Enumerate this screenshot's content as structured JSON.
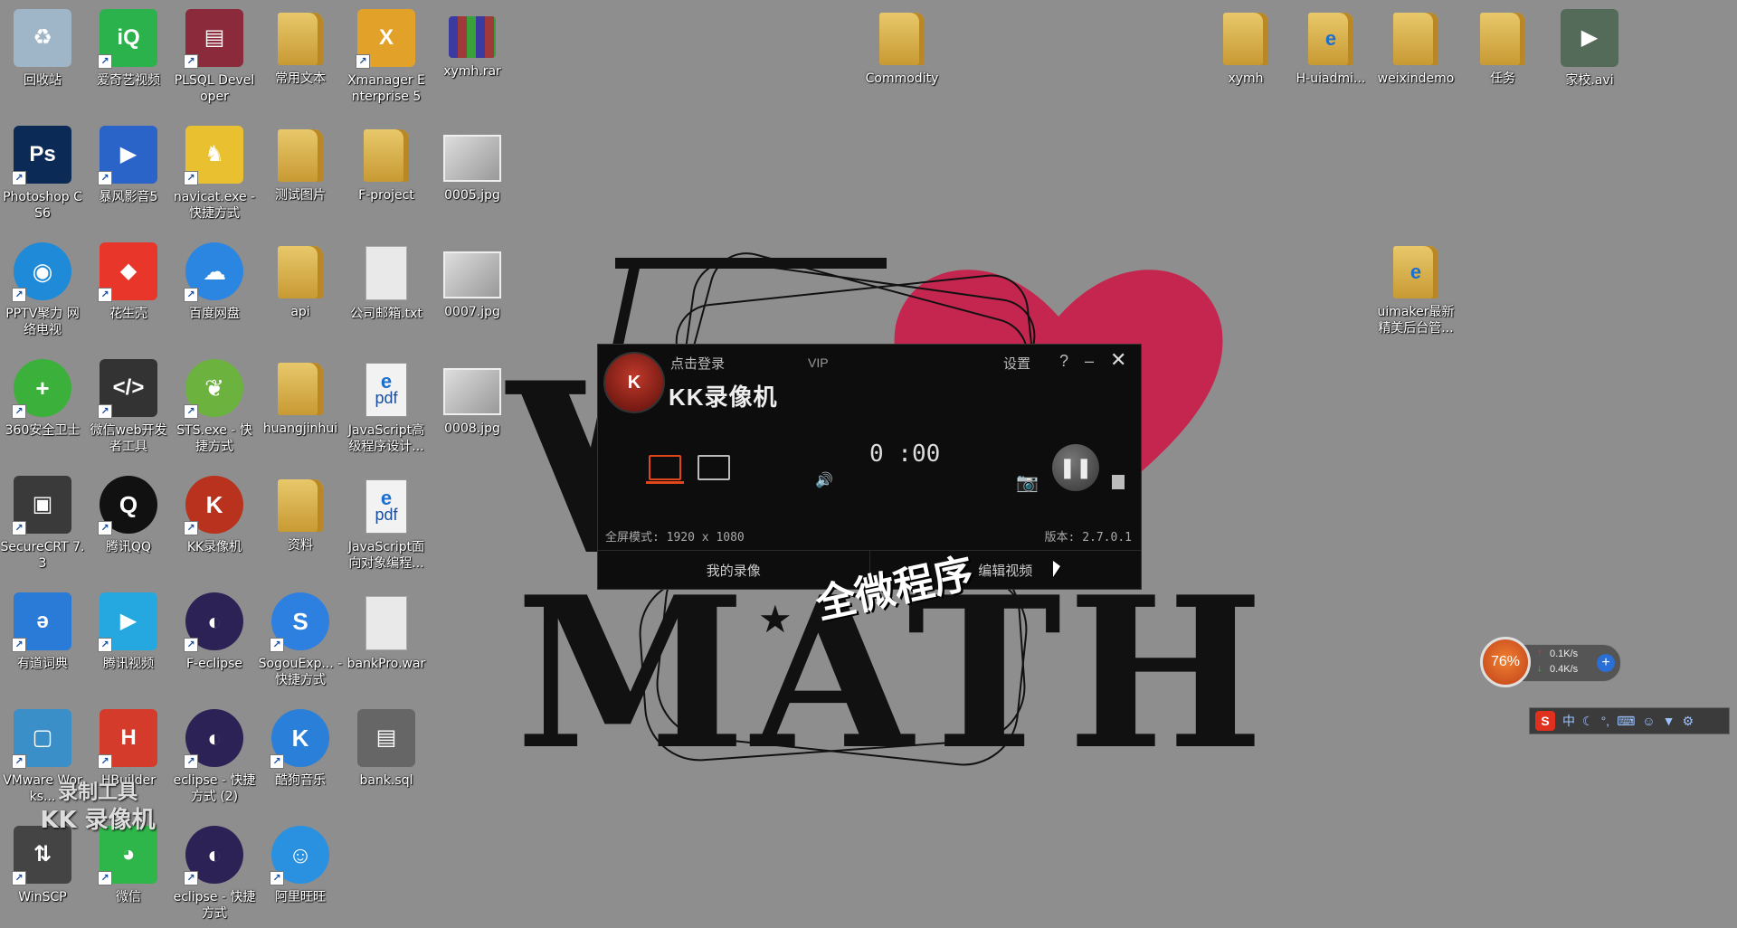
{
  "desktop": {
    "icons": [
      {
        "label": "回收站",
        "kind": "recycle-bin",
        "col": 0,
        "row": 0
      },
      {
        "label": "爱奇艺视频",
        "kind": "iqiyi",
        "col": 1,
        "row": 0
      },
      {
        "label": "PLSQL Developer",
        "kind": "plsql",
        "col": 2,
        "row": 0
      },
      {
        "label": "常用文本",
        "kind": "folder",
        "col": 3,
        "row": 0
      },
      {
        "label": "Xmanager Enterprise 5",
        "kind": "xmanager",
        "col": 4,
        "row": 0
      },
      {
        "label": "xymh.rar",
        "kind": "rar",
        "col": 5,
        "row": 0
      },
      {
        "label": "Photoshop CS6",
        "kind": "photoshop",
        "col": 0,
        "row": 1
      },
      {
        "label": "暴风影音5",
        "kind": "baofeng",
        "col": 1,
        "row": 1
      },
      {
        "label": "navicat.exe - 快捷方式",
        "kind": "navicat",
        "col": 2,
        "row": 1
      },
      {
        "label": "测试图片",
        "kind": "folder",
        "col": 3,
        "row": 1
      },
      {
        "label": "F-project",
        "kind": "folder",
        "col": 4,
        "row": 1
      },
      {
        "label": "0005.jpg",
        "kind": "image",
        "col": 5,
        "row": 1
      },
      {
        "label": "PPTV聚力 网络电视",
        "kind": "pptv",
        "col": 0,
        "row": 2
      },
      {
        "label": "花生壳",
        "kind": "huashengke",
        "col": 1,
        "row": 2
      },
      {
        "label": "百度网盘",
        "kind": "baidu-pan",
        "col": 2,
        "row": 2
      },
      {
        "label": "api",
        "kind": "folder",
        "col": 3,
        "row": 2
      },
      {
        "label": "公司邮箱.txt",
        "kind": "file",
        "col": 4,
        "row": 2
      },
      {
        "label": "0007.jpg",
        "kind": "image",
        "col": 5,
        "row": 2
      },
      {
        "label": "360安全卫士",
        "kind": "360",
        "col": 0,
        "row": 3
      },
      {
        "label": "微信web开发者工具",
        "kind": "wechat-dev",
        "col": 1,
        "row": 3
      },
      {
        "label": "STS.exe - 快捷方式",
        "kind": "sts",
        "col": 2,
        "row": 3
      },
      {
        "label": "huangjinhui",
        "kind": "folder",
        "col": 3,
        "row": 3
      },
      {
        "label": "JavaScript高级程序设计...",
        "kind": "pdf",
        "col": 4,
        "row": 3
      },
      {
        "label": "0008.jpg",
        "kind": "image",
        "col": 5,
        "row": 3
      },
      {
        "label": "SecureCRT 7.3",
        "kind": "securecrt",
        "col": 0,
        "row": 4
      },
      {
        "label": "腾讯QQ",
        "kind": "qq",
        "col": 1,
        "row": 4
      },
      {
        "label": "KK录像机",
        "kind": "kk",
        "col": 2,
        "row": 4
      },
      {
        "label": "资料",
        "kind": "folder",
        "col": 3,
        "row": 4
      },
      {
        "label": "JavaScript面向对象编程...",
        "kind": "pdf",
        "col": 4,
        "row": 4
      },
      {
        "label": "有道词典",
        "kind": "youdao",
        "col": 0,
        "row": 5
      },
      {
        "label": "腾讯视频",
        "kind": "tencent-video",
        "col": 1,
        "row": 5
      },
      {
        "label": "F-eclipse",
        "kind": "eclipse",
        "col": 2,
        "row": 5
      },
      {
        "label": "SogouExp... - 快捷方式",
        "kind": "sogou",
        "col": 3,
        "row": 5
      },
      {
        "label": "bankPro.war",
        "kind": "file",
        "col": 4,
        "row": 5
      },
      {
        "label": "VMware Works...",
        "kind": "vmware",
        "col": 0,
        "row": 6
      },
      {
        "label": "HBuilder",
        "kind": "hbuilder",
        "col": 1,
        "row": 6
      },
      {
        "label": "eclipse - 快捷方式 (2)",
        "kind": "eclipse",
        "col": 2,
        "row": 6
      },
      {
        "label": "酷狗音乐",
        "kind": "kugou",
        "col": 3,
        "row": 6
      },
      {
        "label": "bank.sql",
        "kind": "sql",
        "col": 4,
        "row": 6
      },
      {
        "label": "WinSCP",
        "kind": "winscp",
        "col": 0,
        "row": 7
      },
      {
        "label": "微信",
        "kind": "wechat",
        "col": 1,
        "row": 7
      },
      {
        "label": "eclipse - 快捷方式",
        "kind": "eclipse",
        "col": 2,
        "row": 7
      },
      {
        "label": "阿里旺旺",
        "kind": "wangwang",
        "col": 3,
        "row": 7
      }
    ],
    "right_icons": [
      {
        "label": "Commodity",
        "kind": "folder",
        "slot": "commodity"
      },
      {
        "label": "xymh",
        "kind": "folder",
        "slot": "r0"
      },
      {
        "label": "H-uiadmi...",
        "kind": "folder-ie",
        "slot": "r1"
      },
      {
        "label": "weixindemo",
        "kind": "folder",
        "slot": "r2"
      },
      {
        "label": "任务",
        "kind": "folder",
        "slot": "r3"
      },
      {
        "label": "家校.avi",
        "kind": "video",
        "slot": "r4"
      },
      {
        "label": "uimaker最新精美后台管...",
        "kind": "folder-ie",
        "slot": "r5"
      }
    ]
  },
  "wallpaper": {
    "math_text": "MATH",
    "caption": "全微程序",
    "heart_color": "#c4264f"
  },
  "watermark": {
    "line1": "录制工具",
    "line2": "KK 录像机"
  },
  "recorder": {
    "login_label": "点击登录",
    "vip_label": "VIP",
    "title": "KK录像机",
    "settings_label": "设置",
    "help_label": "?",
    "timer": "0 :00",
    "status": "全屏模式: 1920 x 1080",
    "version": "版本: 2.7.0.1",
    "tabs": [
      "我的录像",
      "编辑视频"
    ],
    "accent_color": "#e0461c"
  },
  "net_widget": {
    "percent": "76%",
    "up": "0.1K/s",
    "down": "0.4K/s"
  },
  "ime": {
    "logo": "S",
    "lang": "中"
  }
}
